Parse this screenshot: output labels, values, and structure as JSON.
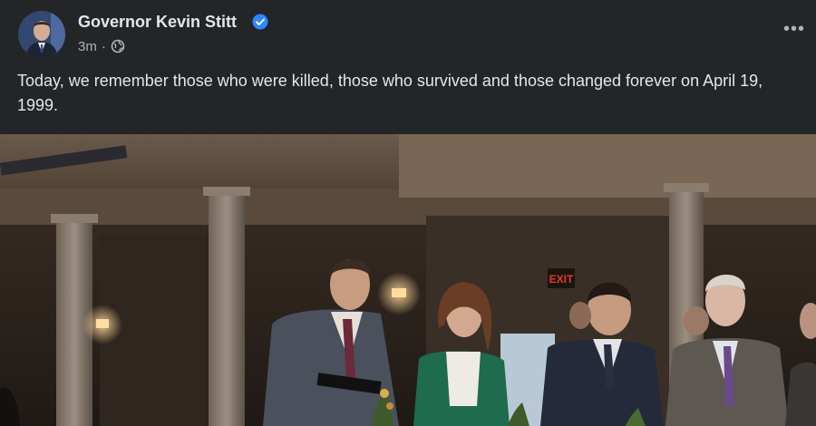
{
  "post": {
    "author": "Governor Kevin Stitt",
    "verified": true,
    "timestamp": "3m",
    "separator": "·",
    "audience_icon": "globe-icon",
    "more_label": "•••",
    "text": "Today, we remember those who were killed, those who survived and those changed forever on April 19, 1999."
  },
  "image": {
    "exit_sign": "EXIT"
  },
  "colors": {
    "background": "#242526",
    "text_primary": "#e4e6eb",
    "text_secondary": "#b0b3b8",
    "verified_badge": "#2d88ff",
    "exit_sign": "#e8362b"
  }
}
